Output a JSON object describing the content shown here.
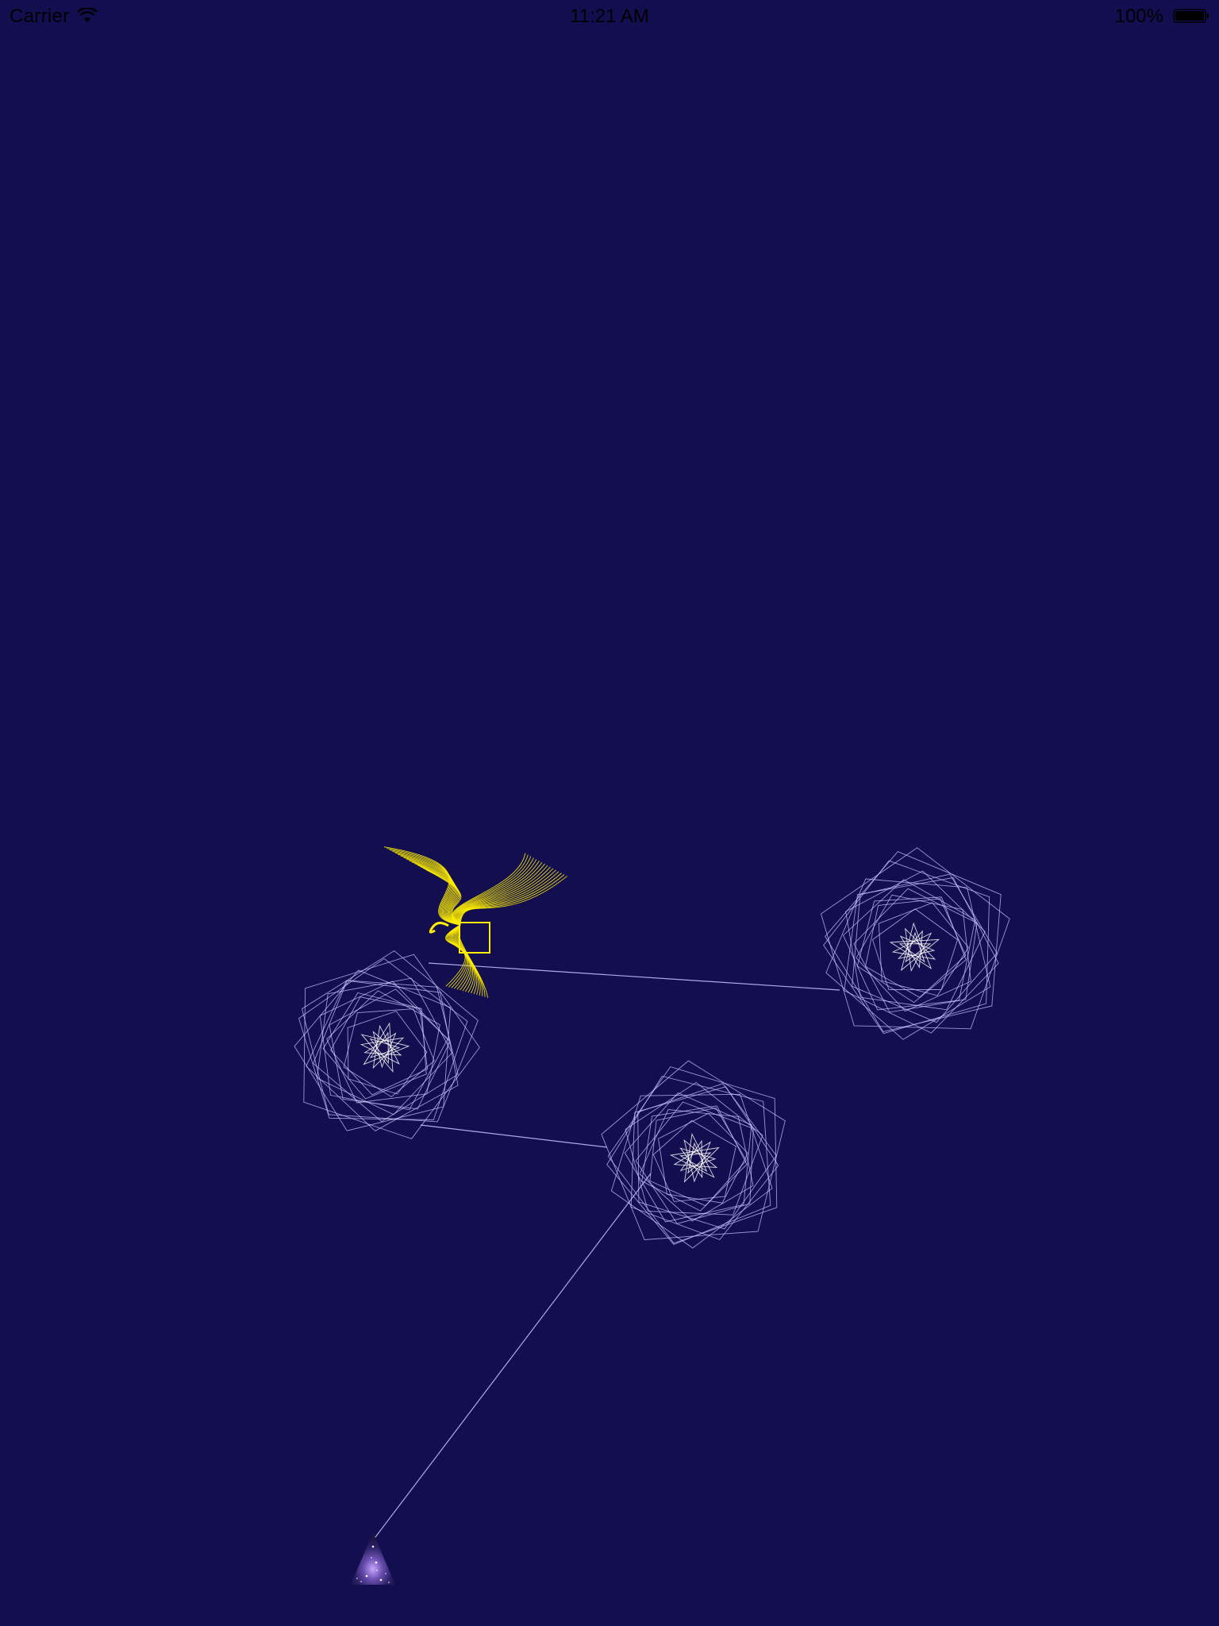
{
  "status_bar": {
    "carrier": "Carrier",
    "time": "11:21 AM",
    "battery_percent": "100%",
    "wifi_icon": "wifi-icon",
    "battery_icon": "battery-icon"
  },
  "scene": {
    "background_color": "#120e50",
    "line_color": "#c8c8ff",
    "yellow_color": "#ffee00",
    "nodes": [
      "pentagon-web",
      "pentagon-web",
      "pentagon-web",
      "yellow-flower",
      "player-triangle"
    ],
    "player_icon": "starry-triangle-icon",
    "target_icon": "yellow-square-icon"
  }
}
